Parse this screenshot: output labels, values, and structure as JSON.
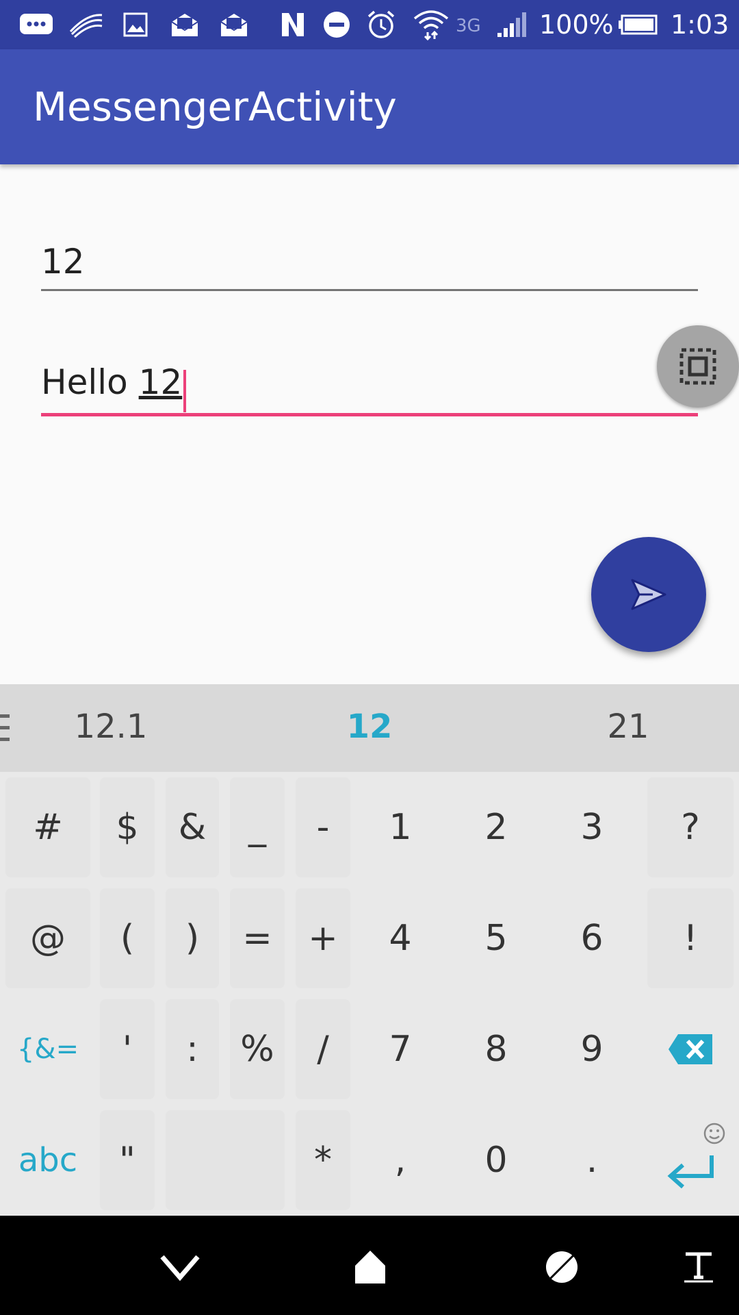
{
  "status_bar": {
    "icons": [
      "messages-icon",
      "swiftkey-icon",
      "gallery-icon",
      "mail-icon",
      "mail-icon",
      "nfc-icon",
      "do-not-disturb-icon",
      "alarm-icon",
      "wifi-icon",
      "3g-icon",
      "signal-icon"
    ],
    "network": "3G",
    "battery": "100%",
    "time": "1:03"
  },
  "app_bar": {
    "title": "MessengerActivity"
  },
  "form": {
    "field1_value": "12",
    "field2_prefix": "Hello ",
    "field2_composing": "12"
  },
  "keyboard": {
    "suggestions": [
      "12.1",
      "12",
      "21"
    ],
    "row1": [
      "#",
      "$",
      "&",
      "_",
      "-",
      "1",
      "2",
      "3",
      "?"
    ],
    "row2": [
      "@",
      "(",
      ")",
      "=",
      "+",
      "4",
      "5",
      "6",
      "!"
    ],
    "row3": [
      "{&=",
      "'",
      ":",
      "%",
      "/",
      "7",
      "8",
      "9"
    ],
    "row4": [
      "abc",
      "\"",
      "*",
      ",",
      "0",
      "."
    ]
  },
  "colors": {
    "primary": "#3f51b5",
    "primary_dark": "#303f9f",
    "accent": "#ec407a",
    "keyboard_accent": "#26a8c9"
  },
  "nav_bar": {
    "icons": [
      "hide-keyboard-icon",
      "home-icon",
      "recents-icon",
      "text-icon"
    ]
  }
}
